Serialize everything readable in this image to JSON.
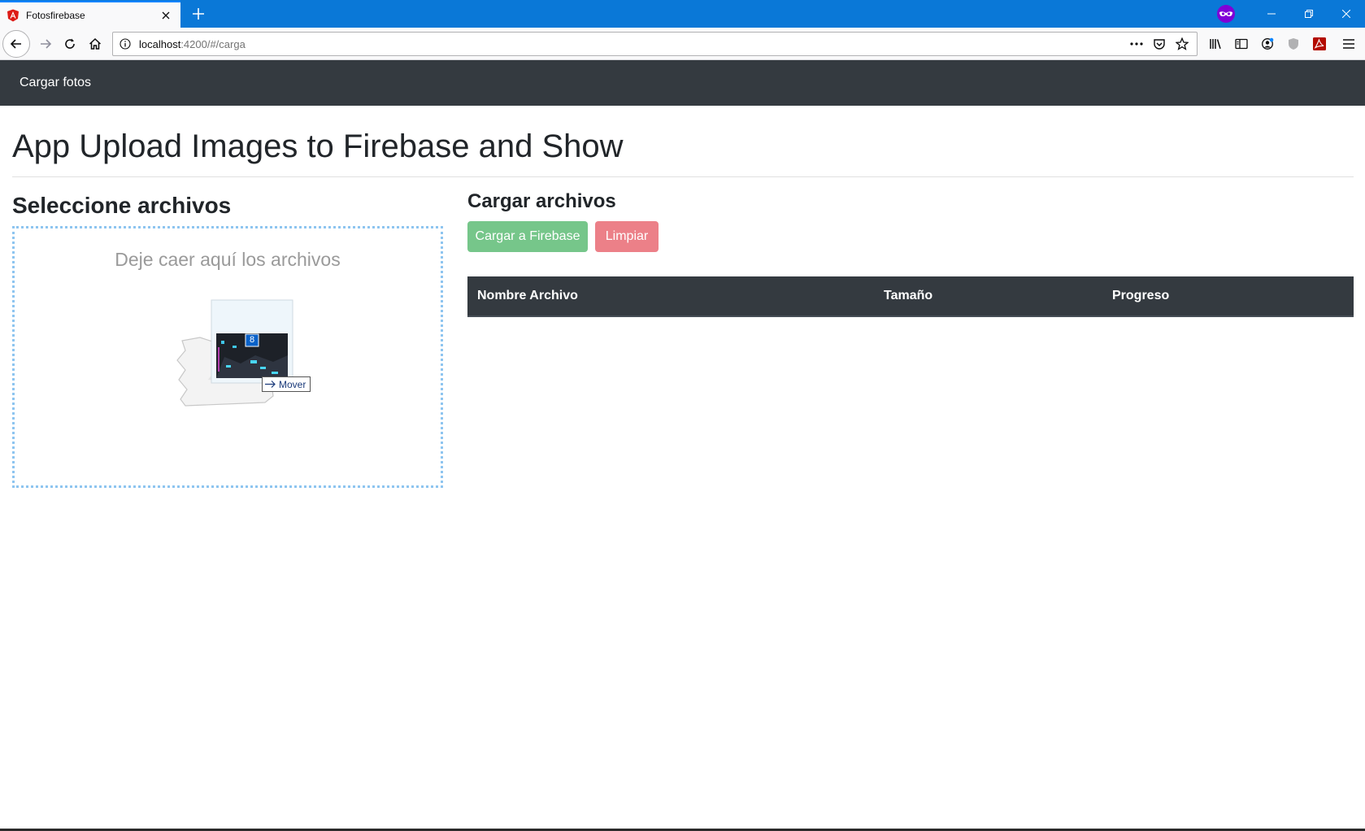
{
  "browser": {
    "tab_title": "Fotosfirebase",
    "url_host": "localhost",
    "url_rest": ":4200/#/carga",
    "icons": [
      "angular-favicon",
      "close-icon",
      "plus-icon",
      "private-browsing-icon",
      "minimize-icon",
      "restore-icon",
      "close-window-icon",
      "back-icon",
      "forward-icon",
      "reload-icon",
      "home-icon",
      "info-icon",
      "more-icon",
      "pocket-icon",
      "star-icon",
      "library-icon",
      "sidebar-icon",
      "account-icon",
      "shield-icon",
      "pdf-icon",
      "menu-icon"
    ]
  },
  "app": {
    "brand": "Cargar fotos",
    "title": "App Upload Images to Firebase and Show"
  },
  "select": {
    "heading": "Seleccione archivos",
    "drop_text": "Deje caer aquí los archivos",
    "drag_count": "8",
    "drag_action": "Mover"
  },
  "upload": {
    "heading": "Cargar archivos",
    "upload_button": "Cargar a Firebase",
    "clear_button": "Limpiar",
    "table_headers": [
      "Nombre Archivo",
      "Tamaño",
      "Progreso"
    ]
  },
  "colors": {
    "navbar": "#343a40",
    "success": "#76c68a",
    "danger": "#ec8088",
    "titlebar": "#0a78d7"
  }
}
